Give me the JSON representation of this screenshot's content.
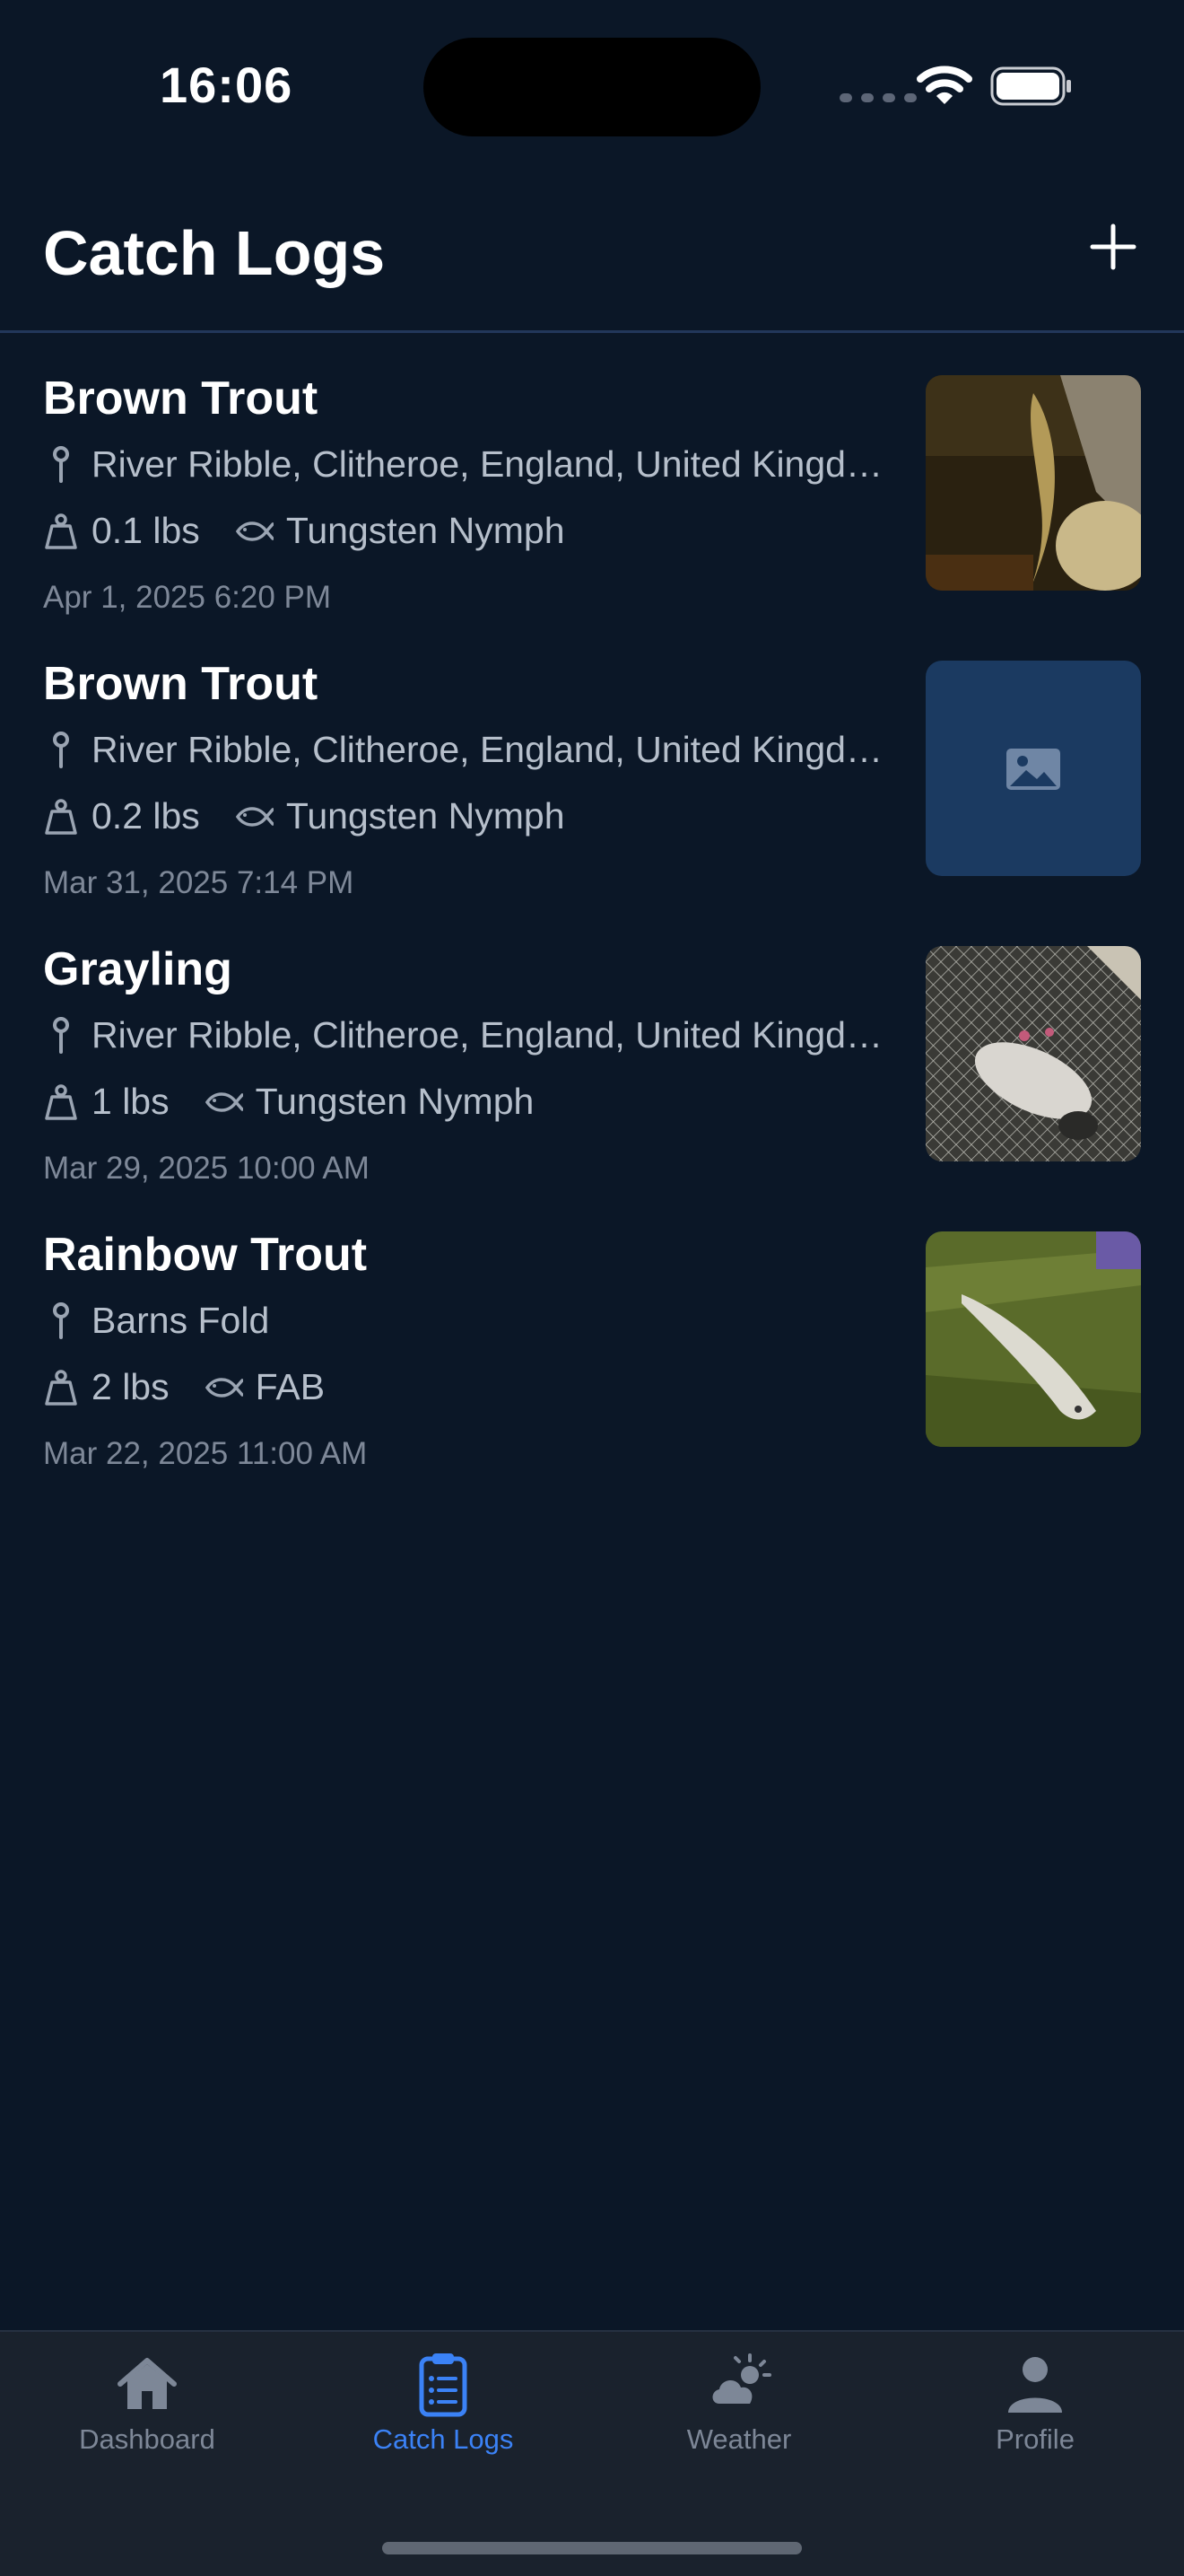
{
  "status_bar": {
    "time": "16:06"
  },
  "header": {
    "title": "Catch Logs",
    "add_icon": "plus-icon"
  },
  "colors": {
    "background": "#0b1727",
    "accent": "#3b82f6",
    "placeholder": "#1b3a61"
  },
  "catches": [
    {
      "species": "Brown Trout",
      "location": "River Ribble, Clitheroe, England, United Kingdom",
      "weight": "0.1 lbs",
      "fly": "Tungsten Nymph",
      "date": "Apr 1, 2025 6:20 PM",
      "image": "photo-brown-trout-rocks"
    },
    {
      "species": "Brown Trout",
      "location": "River Ribble, Clitheroe, England, United Kingdom",
      "weight": "0.2 lbs",
      "fly": "Tungsten Nymph",
      "date": "Mar 31, 2025 7:14 PM",
      "image": "image-placeholder-icon"
    },
    {
      "species": "Grayling",
      "location": "River Ribble, Clitheroe, England, United Kingdom",
      "weight": "1 lbs",
      "fly": "Tungsten Nymph",
      "date": "Mar 29, 2025 10:00 AM",
      "image": "photo-grayling-net"
    },
    {
      "species": "Rainbow Trout",
      "location": "Barns Fold",
      "weight": "2 lbs",
      "fly": "FAB",
      "date": "Mar 22, 2025 11:00 AM",
      "image": "photo-rainbow-trout-grass"
    }
  ],
  "tabs": [
    {
      "label": "Dashboard",
      "icon": "house-icon",
      "active": false
    },
    {
      "label": "Catch Logs",
      "icon": "clipboard-list-icon",
      "active": true
    },
    {
      "label": "Weather",
      "icon": "cloud-sun-icon",
      "active": false
    },
    {
      "label": "Profile",
      "icon": "person-icon",
      "active": false
    }
  ]
}
